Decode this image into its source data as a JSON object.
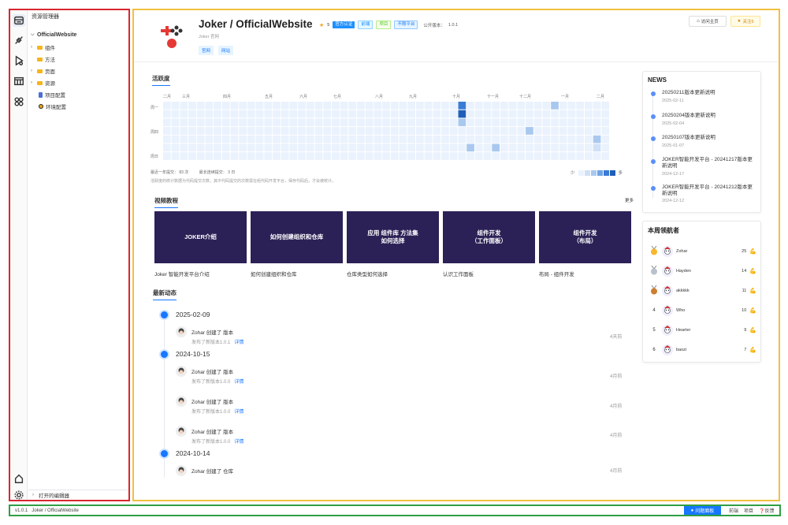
{
  "sidebar": {
    "explorer_title": "资源管理器",
    "project_name": "OfficialWebsite",
    "tree": [
      {
        "label": "组件",
        "type": "folder",
        "expandable": true
      },
      {
        "label": "方法",
        "type": "folder",
        "expandable": false
      },
      {
        "label": "页面",
        "type": "folder",
        "expandable": true
      },
      {
        "label": "资源",
        "type": "folder",
        "expandable": true
      },
      {
        "label": "项目配置",
        "type": "file"
      },
      {
        "label": "环境配置",
        "type": "file"
      }
    ],
    "open_editors": "打开的编辑器",
    "activity_icons": [
      "files-icon",
      "plugin-icon",
      "run-debug-icon",
      "calendar-grid-icon",
      "components-icon",
      "home-icon",
      "settings-icon"
    ]
  },
  "header": {
    "title": "Joker / OfficialWebsite",
    "star_count": "5",
    "tags": [
      "官方认证",
      "前端",
      "项目",
      "不限平台"
    ],
    "version_label": "公开版本：",
    "version": "1.0.1",
    "subtitle": "Joker 官网",
    "chips": [
      "官网",
      "网站"
    ],
    "visit_button": "访问主页",
    "follow_button": "关注5"
  },
  "activity": {
    "title": "活跃度",
    "months": [
      "二月",
      "三月",
      "四月",
      "五月",
      "六月",
      "七月",
      "八月",
      "九月",
      "十月",
      "十一月",
      "十二月",
      "一月",
      "二月"
    ],
    "weekdays": [
      "周一",
      "周四",
      "周日"
    ],
    "year_label": "最近一年提交：",
    "year_value": "83 次",
    "streak_label": "最长连续提交：",
    "streak_value": "3 日",
    "note": "活跃度的统计数据为代码提交次数，其中代码提交的次数需在组代码开发平台，保存代码后，才会被统计。",
    "legend_less": "少",
    "legend_more": "多",
    "colors": [
      "#eaf2fd",
      "#cfe0f7",
      "#a9c8ef",
      "#6fa4e3",
      "#3a7bd5",
      "#1f5fb8"
    ]
  },
  "videos": {
    "title": "视频教程",
    "more": "更多",
    "items": [
      {
        "thumb": "JOKER介绍",
        "caption": "Joker 智能开发平台介绍"
      },
      {
        "thumb": "如何创建组织和仓库",
        "caption": "如何创建组织和仓库"
      },
      {
        "thumb": "应用 组件库 方法集\n如何选择",
        "caption": "仓库类型如何选择"
      },
      {
        "thumb": "组件开发\n（工作面板）",
        "caption": "认识工作面板"
      },
      {
        "thumb": "组件开发\n（布局）",
        "caption": "布局 - 组件开发"
      }
    ]
  },
  "timeline": {
    "title": "最新动态",
    "groups": [
      {
        "date": "2025-02-09",
        "items": [
          {
            "text": "Zohar 创建了 版本",
            "sub": "发布了新版本1.0.1",
            "link": "详情",
            "time": "4天前"
          }
        ]
      },
      {
        "date": "2024-10-15",
        "items": [
          {
            "text": "Zohar 创建了 版本",
            "sub": "发布了新版本1.0.0",
            "link": "详情",
            "time": "4月前"
          },
          {
            "text": "Zohar 创建了 版本",
            "sub": "发布了新版本1.0.0",
            "link": "详情",
            "time": "4月前"
          },
          {
            "text": "Zohar 创建了 版本",
            "sub": "发布了新版本1.0.0",
            "link": "详情",
            "time": "4月前"
          }
        ]
      },
      {
        "date": "2024-10-14",
        "items": [
          {
            "text": "Zohar 创建了 仓库",
            "sub": "",
            "link": "",
            "time": "4月前"
          }
        ]
      }
    ]
  },
  "news": {
    "title": "NEWS",
    "items": [
      {
        "title": "20250211版本更新说明",
        "date": "2025-02-11"
      },
      {
        "title": "20250204版本更新说明",
        "date": "2025-02-04"
      },
      {
        "title": "20250107版本更新说明",
        "date": "2025-01-07"
      },
      {
        "title": "JOKER智能开发平台 - 20241217版本更新说明",
        "date": "2024-12-17"
      },
      {
        "title": "JOKER智能开发平台 - 20241212版本更新说明",
        "date": "2024-12-12"
      }
    ]
  },
  "leaderboard": {
    "title": "本周领航者",
    "rows": [
      {
        "rank": "1",
        "name": "Zohar",
        "score": "25"
      },
      {
        "rank": "2",
        "name": "Hayden",
        "score": "14"
      },
      {
        "rank": "3",
        "name": "akkkkk",
        "score": "11"
      },
      {
        "rank": "4",
        "name": "Who",
        "score": "10"
      },
      {
        "rank": "5",
        "name": "Hearter",
        "score": "9"
      },
      {
        "rank": "6",
        "name": "baozi",
        "score": "7"
      }
    ]
  },
  "statusbar": {
    "version": "v1.0.1",
    "path": "Joker / OfficialWebsite",
    "issue_button": "问题面板",
    "items": [
      "前端",
      "项目",
      "反馈"
    ]
  }
}
